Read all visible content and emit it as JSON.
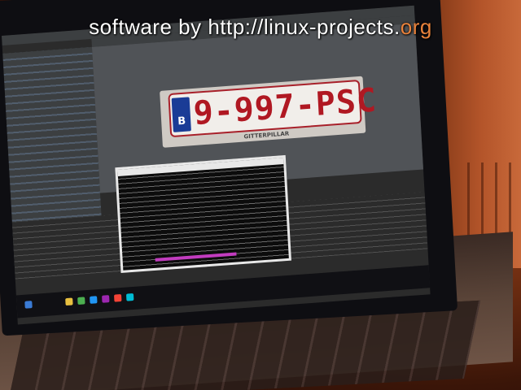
{
  "watermark": {
    "prefix": "software by http://linux-projects.",
    "suffix": "org",
    "suffix_color": "#e8823c"
  },
  "license_plate": {
    "country_code": "B",
    "number": "9-997-PSC",
    "dealer_frame": "GITTERPILLAR"
  },
  "colors": {
    "plate_red": "#b01822",
    "eu_blue": "#1a3c96",
    "terminal_highlight": "#c23cbf"
  }
}
